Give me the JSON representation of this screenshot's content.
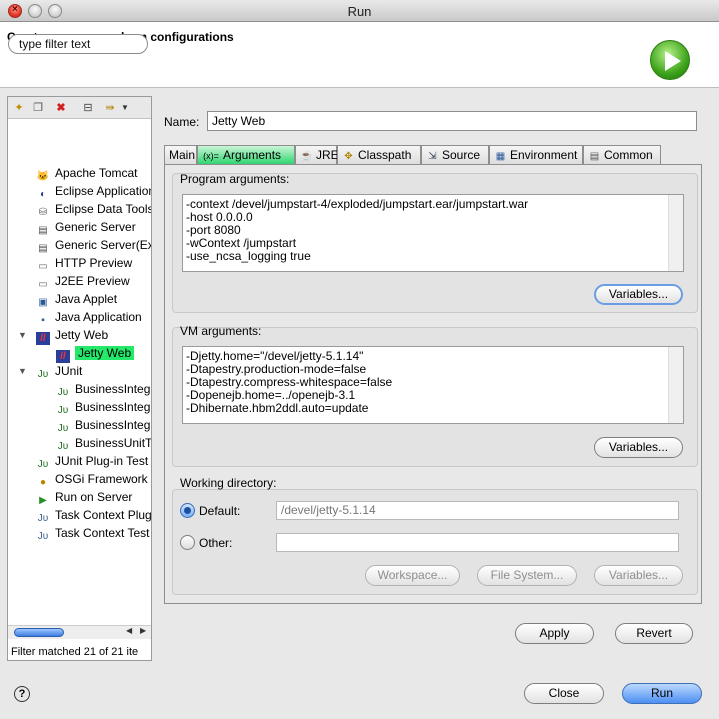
{
  "window": {
    "title": "Run"
  },
  "header": {
    "title": "Create, manage, and run configurations",
    "icon": "run-icon"
  },
  "left": {
    "filter_text": "type filter text",
    "tree": [
      {
        "label": "Apache Tomcat",
        "icon": "tomcat-icon",
        "indent": 0
      },
      {
        "label": "Eclipse Application",
        "icon": "eclipse-icon",
        "indent": 0
      },
      {
        "label": "Eclipse Data Tools",
        "icon": "database-icon",
        "indent": 0
      },
      {
        "label": "Generic Server",
        "icon": "server-icon",
        "indent": 0
      },
      {
        "label": "Generic Server(Ext",
        "icon": "server-icon",
        "indent": 0
      },
      {
        "label": "HTTP Preview",
        "icon": "page-icon",
        "indent": 0
      },
      {
        "label": "J2EE Preview",
        "icon": "page-icon",
        "indent": 0
      },
      {
        "label": "Java Applet",
        "icon": "applet-icon",
        "indent": 0
      },
      {
        "label": "Java Application",
        "icon": "java-app-icon",
        "indent": 0
      },
      {
        "label": "Jetty Web",
        "icon": "jetty-icon",
        "indent": 0,
        "expanded": true
      },
      {
        "label": "Jetty Web",
        "icon": "jetty-icon",
        "indent": 1,
        "selected": true
      },
      {
        "label": "JUnit",
        "icon": "junit-icon",
        "indent": 0,
        "expanded": true
      },
      {
        "label": "BusinessInteg",
        "icon": "junit-icon",
        "indent": 1
      },
      {
        "label": "BusinessInteg",
        "icon": "junit-icon",
        "indent": 1
      },
      {
        "label": "BusinessInteg",
        "icon": "junit-icon",
        "indent": 1
      },
      {
        "label": "BusinessUnitT",
        "icon": "junit-icon",
        "indent": 1
      },
      {
        "label": "JUnit Plug-in Test",
        "icon": "junit-icon",
        "indent": 0
      },
      {
        "label": "OSGi Framework",
        "icon": "osgi-icon",
        "indent": 0
      },
      {
        "label": "Run on Server",
        "icon": "server-run-icon",
        "indent": 0
      },
      {
        "label": "Task Context Plug",
        "icon": "task-icon",
        "indent": 0
      },
      {
        "label": "Task Context Test",
        "icon": "task-icon",
        "indent": 0
      }
    ],
    "status": "Filter matched 21 of 21 ite"
  },
  "main": {
    "name_label": "Name:",
    "name_value": "Jetty Web",
    "tabs": [
      {
        "label": "Main"
      },
      {
        "label": "Arguments",
        "icon_text": "(x)=",
        "active": true
      },
      {
        "label": "JRE"
      },
      {
        "label": "Classpath"
      },
      {
        "label": "Source"
      },
      {
        "label": "Environment"
      },
      {
        "label": "Common"
      }
    ],
    "program_args": {
      "label": "Program arguments:",
      "lines": [
        "-context /devel/jumpstart-4/exploded/jumpstart.ear/jumpstart.war",
        "-host 0.0.0.0",
        "-port 8080",
        "-wContext /jumpstart",
        "-use_ncsa_logging true"
      ],
      "variables": "Variables..."
    },
    "vm_args": {
      "label": "VM arguments:",
      "lines": [
        "-Djetty.home=\"/devel/jetty-5.1.14\"",
        "-Dtapestry.production-mode=false",
        "-Dtapestry.compress-whitespace=false",
        "-Dopenejb.home=../openejb-3.1",
        "-Dhibernate.hbm2ddl.auto=update"
      ],
      "variables": "Variables..."
    },
    "working_dir": {
      "label": "Working directory:",
      "default_label": "Default:",
      "default_value": "/devel/jetty-5.1.14",
      "other_label": "Other:",
      "other_value": "",
      "workspace": "Workspace...",
      "filesystem": "File System...",
      "variables": "Variables..."
    },
    "apply": "Apply",
    "revert": "Revert"
  },
  "footer": {
    "close": "Close",
    "run": "Run",
    "help": "?"
  }
}
